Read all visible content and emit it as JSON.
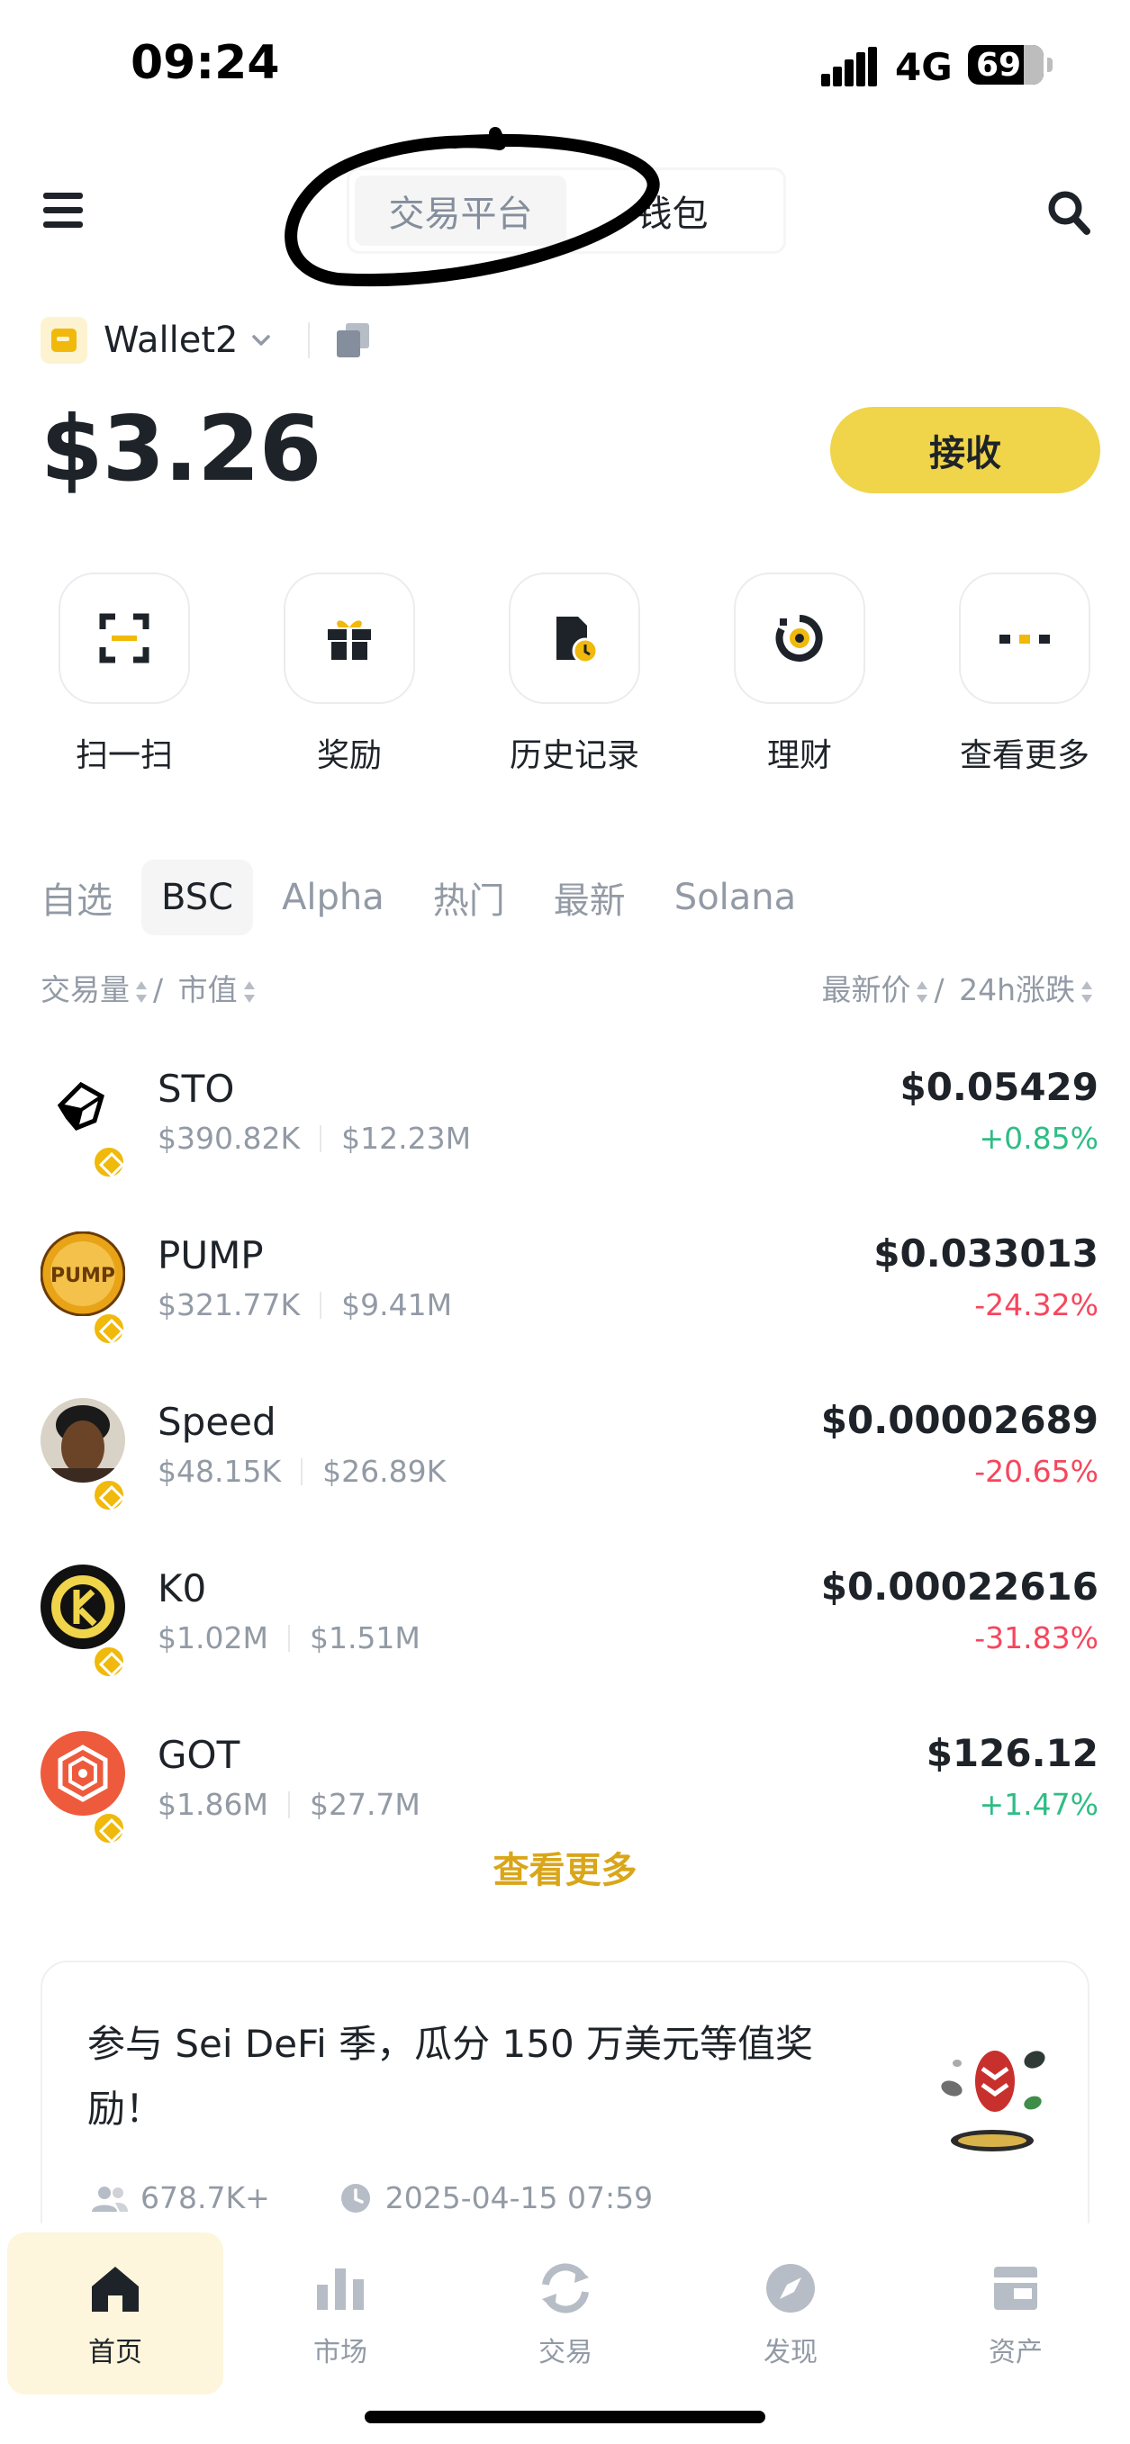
{
  "status_bar": {
    "time": "09:24",
    "network": "4G",
    "battery": "69"
  },
  "header": {
    "tabs": [
      {
        "label": "交易平台",
        "active": false
      },
      {
        "label": "钱包",
        "active": true
      }
    ]
  },
  "wallet": {
    "name": "Wallet2",
    "balance": "$3.26",
    "receive_label": "接收"
  },
  "quick_actions": [
    {
      "label": "扫一扫",
      "icon": "scan-icon"
    },
    {
      "label": "奖励",
      "icon": "gift-icon"
    },
    {
      "label": "历史记录",
      "icon": "history-icon"
    },
    {
      "label": "理财",
      "icon": "earn-icon"
    },
    {
      "label": "查看更多",
      "icon": "more-icon"
    }
  ],
  "market_tabs": [
    {
      "label": "自选",
      "active": false
    },
    {
      "label": "BSC",
      "active": true
    },
    {
      "label": "Alpha",
      "active": false
    },
    {
      "label": "热门",
      "active": false
    },
    {
      "label": "最新",
      "active": false
    },
    {
      "label": "Solana",
      "active": false
    }
  ],
  "columns": {
    "volume": "交易量",
    "sep": "/",
    "mcap": "市值",
    "price": "最新价",
    "change": "24h涨跌"
  },
  "tokens": [
    {
      "symbol": "STO",
      "volume": "$390.82K",
      "mcap": "$12.23M",
      "price": "$0.05429",
      "change": "+0.85%",
      "direction": "up"
    },
    {
      "symbol": "PUMP",
      "volume": "$321.77K",
      "mcap": "$9.41M",
      "price": "$0.033013",
      "change": "-24.32%",
      "direction": "down"
    },
    {
      "symbol": "Speed",
      "volume": "$48.15K",
      "mcap": "$26.89K",
      "price": "$0.00002689",
      "change": "-20.65%",
      "direction": "down"
    },
    {
      "symbol": "K0",
      "volume": "$1.02M",
      "mcap": "$1.51M",
      "price": "$0.00022616",
      "change": "-31.83%",
      "direction": "down"
    },
    {
      "symbol": "GOT",
      "volume": "$1.86M",
      "mcap": "$27.7M",
      "price": "$126.12",
      "change": "+1.47%",
      "direction": "up"
    }
  ],
  "see_more": "查看更多",
  "promo": {
    "title": "参与 Sei DeFi 季，瓜分 150 万美元等值奖励！",
    "participants": "678.7K+",
    "datetime": "2025-04-15 07:59"
  },
  "bottom_nav": [
    {
      "label": "首页",
      "icon": "home-icon",
      "active": true
    },
    {
      "label": "市场",
      "icon": "market-icon",
      "active": false
    },
    {
      "label": "交易",
      "icon": "trade-icon",
      "active": false
    },
    {
      "label": "发现",
      "icon": "discover-icon",
      "active": false
    },
    {
      "label": "资产",
      "icon": "assets-icon",
      "active": false
    }
  ],
  "colors": {
    "accent": "#f0d44a",
    "up": "#2ebd85",
    "down": "#f6465d",
    "link": "#d9a61a"
  }
}
